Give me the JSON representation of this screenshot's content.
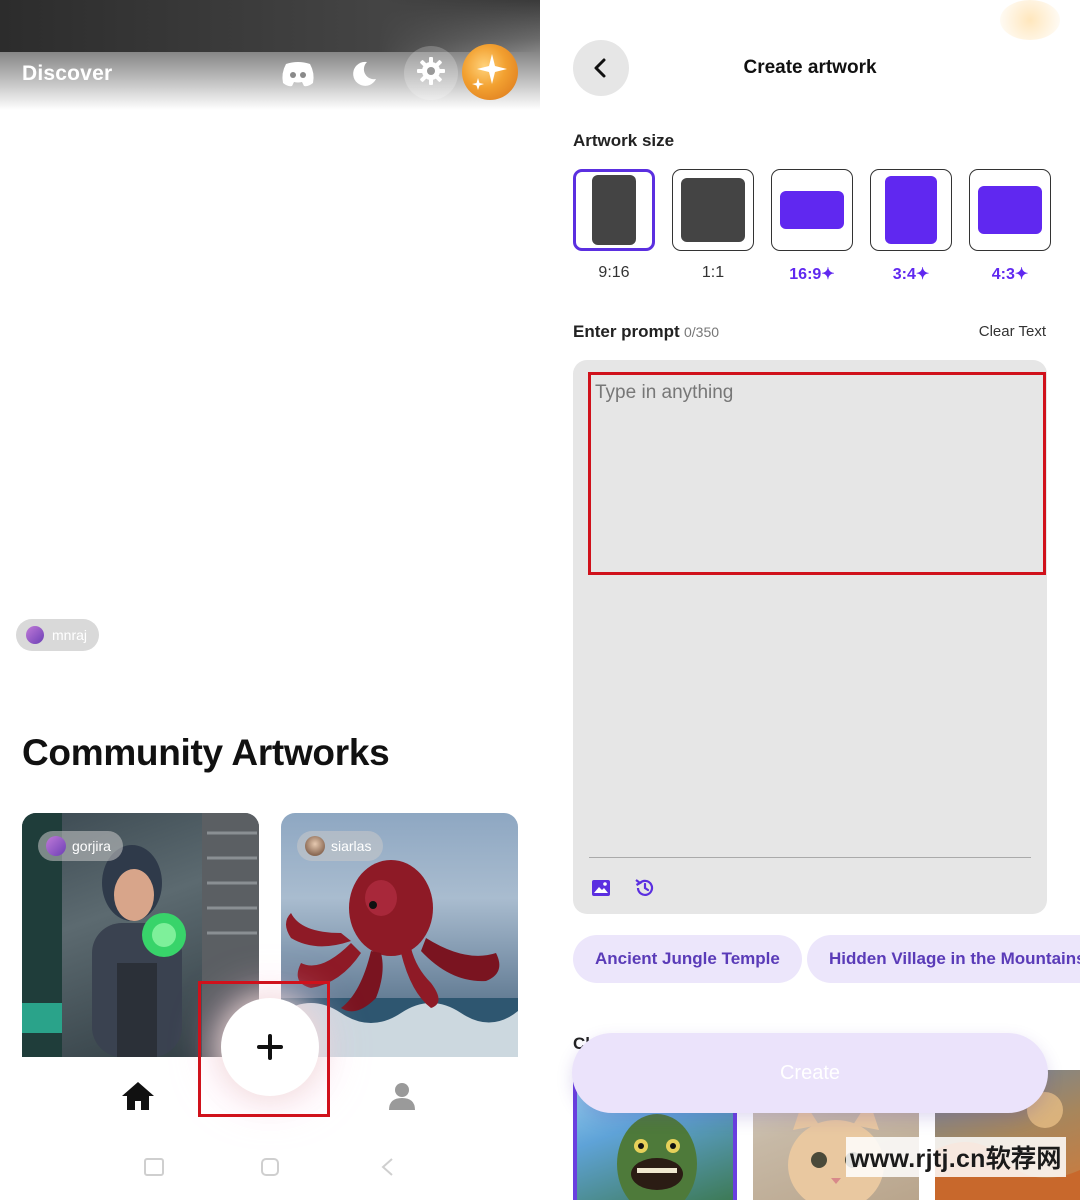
{
  "left": {
    "header": {
      "title": "Discover"
    },
    "featured": {
      "username": "mnraj"
    },
    "community": {
      "title": "Community Artworks",
      "cards": [
        {
          "username": "gorjira"
        },
        {
          "username": "siarlas"
        }
      ]
    },
    "fab": {
      "icon": "plus-icon"
    },
    "nav": {
      "home_icon": "home-icon",
      "profile_icon": "profile-icon"
    }
  },
  "right": {
    "header": {
      "title": "Create artwork"
    },
    "artwork_size": {
      "label": "Artwork size",
      "options": [
        {
          "label": "9:16",
          "premium": false,
          "selected": true
        },
        {
          "label": "1:1",
          "premium": false,
          "selected": false
        },
        {
          "label": "16:9✦",
          "premium": true,
          "selected": false
        },
        {
          "label": "3:4✦",
          "premium": true,
          "selected": false
        },
        {
          "label": "4:3✦",
          "premium": true,
          "selected": false
        }
      ]
    },
    "prompt": {
      "label": "Enter prompt",
      "counter": "0/350",
      "clear_label": "Clear Text",
      "placeholder": "Type in anything",
      "value": ""
    },
    "suggestions": [
      "Ancient Jungle Temple",
      "Hidden Village in the Mountains"
    ],
    "collection_label": "Ch",
    "create_label": "Create"
  },
  "watermark": "www.rjtj.cn软荐网",
  "colors": {
    "accent": "#6028f0",
    "accent_light": "#ece6fb",
    "highlight": "#d0111b"
  }
}
